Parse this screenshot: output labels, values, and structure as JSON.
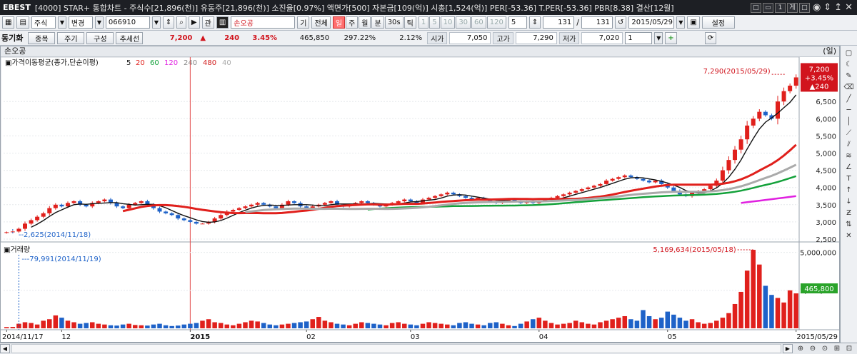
{
  "window": {
    "logo": "EBEST",
    "title": "[4000] STAR+ 통합차트 - 주식수[21,896(천)] 유동주[21,896(천)] 소진율[0.97%] 액면가[500] 자본금[109(억)] 시총[1,524(억)] PER[-53.36] T.PER[-53.36] PBR[8.38] 결산[12월]",
    "buttons": [
      "□",
      "▭",
      "1",
      "게",
      "□"
    ],
    "controls": [
      "◉",
      "⇕",
      "↥",
      "✕"
    ]
  },
  "toolbar1": {
    "market": "주식",
    "mode": "변경",
    "code": "066910",
    "rel": "관",
    "stock_name": "손오공",
    "gi": "기",
    "all": "전체",
    "periods": [
      {
        "label": "일",
        "selected": true
      },
      {
        "label": "주",
        "selected": false
      },
      {
        "label": "월",
        "selected": false
      },
      {
        "label": "분",
        "selected": false
      },
      {
        "label": "30s",
        "selected": false
      },
      {
        "label": "틱",
        "selected": false
      }
    ],
    "intervals": [
      "1",
      "5",
      "10",
      "30",
      "60",
      "120"
    ],
    "interval_value": "5",
    "count_a": "131",
    "count_b": "131",
    "date": "2015/05/29",
    "settings": "설정"
  },
  "toolbar2": {
    "label": "동기화",
    "buttons": [
      "종목",
      "주기",
      "구성",
      "추세선"
    ],
    "price": "7,200",
    "arrow": "▲",
    "change": "240",
    "change_pct": "3.45%",
    "volume": "465,850",
    "vol_ratio": "297.22%",
    "turnover": "2.12%",
    "open_label": "시가",
    "open": "7,050",
    "high_label": "고가",
    "high": "7,290",
    "low_label": "저가",
    "low": "7,020",
    "spin": "1"
  },
  "chart_header": {
    "stock": "손오공",
    "unit": "(일)"
  },
  "chart_data": [
    {
      "type": "candlestick",
      "legend_title": "가격이동평균(종가,단순이평)",
      "ma_periods": [
        {
          "label": "5",
          "color": "#111111"
        },
        {
          "label": "20",
          "color": "#e0201c"
        },
        {
          "label": "60",
          "color": "#13a13a"
        },
        {
          "label": "120",
          "color": "#e020e0"
        },
        {
          "label": "240",
          "color": "#888888"
        },
        {
          "label": "480",
          "color": "#d21e1e"
        },
        {
          "label": "40",
          "color": "#aaaaaa"
        }
      ],
      "x_range": [
        "2014/11/17",
        "2015/05/29"
      ],
      "ylim": [
        2500,
        7500
      ],
      "y_ticks": [
        2500,
        3000,
        3500,
        4000,
        4500,
        5000,
        5500,
        6000,
        6500
      ],
      "y_tick_labels": [
        "2,500",
        "3,000",
        "3,500",
        "4,000",
        "4,500",
        "5,000",
        "5,500",
        "6,000",
        "6,500"
      ],
      "annotations": [
        {
          "text": "7,290(2015/05/29)",
          "value": 7290
        },
        {
          "text": "2,625(2014/11/18)",
          "value": 2625
        }
      ],
      "last_price_box": [
        "7,200",
        "+3.45%",
        "▲240"
      ],
      "closes": [
        2700,
        2720,
        2800,
        2950,
        3050,
        3150,
        3250,
        3400,
        3500,
        3450,
        3550,
        3600,
        3500,
        3450,
        3550,
        3600,
        3650,
        3550,
        3450,
        3400,
        3500,
        3550,
        3600,
        3500,
        3400,
        3300,
        3250,
        3200,
        3100,
        3050,
        3000,
        2950,
        2950,
        3000,
        3100,
        3200,
        3300,
        3350,
        3400,
        3450,
        3500,
        3550,
        3500,
        3450,
        3400,
        3500,
        3600,
        3550,
        3450,
        3400,
        3450,
        3500,
        3550,
        3600,
        3500,
        3450,
        3500,
        3550,
        3600,
        3550,
        3500,
        3450,
        3500,
        3550,
        3600,
        3650,
        3600,
        3550,
        3650,
        3700,
        3750,
        3800,
        3850,
        3800,
        3750,
        3700,
        3650,
        3700,
        3650,
        3600,
        3550,
        3600,
        3650,
        3600,
        3550,
        3600,
        3550,
        3600,
        3650,
        3700,
        3750,
        3800,
        3850,
        3900,
        3950,
        4000,
        4050,
        4100,
        4200,
        4250,
        4300,
        4350,
        4300,
        4250,
        4200,
        4150,
        4200,
        4100,
        4000,
        3900,
        3800,
        3750,
        3850,
        3900,
        3950,
        4050,
        4200,
        4500,
        4800,
        5100,
        5400,
        5800,
        6000,
        6200,
        6100,
        6000,
        6500,
        6800,
        6960,
        7200
      ]
    },
    {
      "type": "bar",
      "title": "거래량",
      "ylim": [
        0,
        5500000
      ],
      "y_ticks": [
        2500000,
        5000000
      ],
      "y_tick_labels": [
        "2,500,000",
        "5,000,000"
      ],
      "annotations": [
        {
          "text": "5,169,634(2015/05/18)",
          "value": 5169634
        },
        {
          "text": "79,991(2014/11/19)",
          "value": 79991
        }
      ],
      "last_volume_box": "465,800",
      "values": [
        80000,
        90000,
        300000,
        400000,
        350000,
        250000,
        500000,
        600000,
        850000,
        700000,
        500000,
        400000,
        300000,
        350000,
        400000,
        300000,
        250000,
        200000,
        180000,
        250000,
        300000,
        220000,
        200000,
        180000,
        250000,
        300000,
        200000,
        150000,
        180000,
        250000,
        300000,
        350000,
        500000,
        600000,
        400000,
        350000,
        250000,
        200000,
        300000,
        400000,
        500000,
        450000,
        350000,
        250000,
        200000,
        250000,
        300000,
        350000,
        400000,
        450000,
        600000,
        750000,
        500000,
        400000,
        300000,
        250000,
        200000,
        300000,
        400000,
        350000,
        300000,
        250000,
        200000,
        350000,
        400000,
        300000,
        250000,
        200000,
        300000,
        400000,
        350000,
        300000,
        250000,
        200000,
        350000,
        400000,
        300000,
        250000,
        200000,
        350000,
        400000,
        300000,
        200000,
        150000,
        300000,
        450000,
        600000,
        700000,
        500000,
        350000,
        250000,
        300000,
        350000,
        500000,
        400000,
        300000,
        250000,
        400000,
        500000,
        600000,
        700000,
        800000,
        600000,
        500000,
        1200000,
        800000,
        600000,
        700000,
        1100000,
        900000,
        700000,
        500000,
        600000,
        400000,
        300000,
        350000,
        500000,
        700000,
        1000000,
        1600000,
        2400000,
        3800000,
        5169634,
        4200000,
        2800000,
        2200000,
        2000000,
        1700000,
        2500000,
        2300000,
        1900000,
        465800
      ],
      "up_days_from_series": "closes"
    }
  ],
  "x_axis": {
    "labels": [
      "2014/11/17",
      "12",
      "2015",
      "02",
      "03",
      "04",
      "05",
      "2015/05/29"
    ]
  },
  "sidebar_icons": [
    "fit-icon",
    "cross-icon",
    "pen-icon",
    "eraser-icon",
    "line-icon",
    "hline-icon",
    "vline-icon",
    "trend-icon",
    "channel-icon",
    "fib-icon",
    "gann-icon",
    "text-icon",
    "arrow-up-icon",
    "arrow-down-icon",
    "zz-icon",
    "arrows-icon",
    "clear-icon"
  ]
}
